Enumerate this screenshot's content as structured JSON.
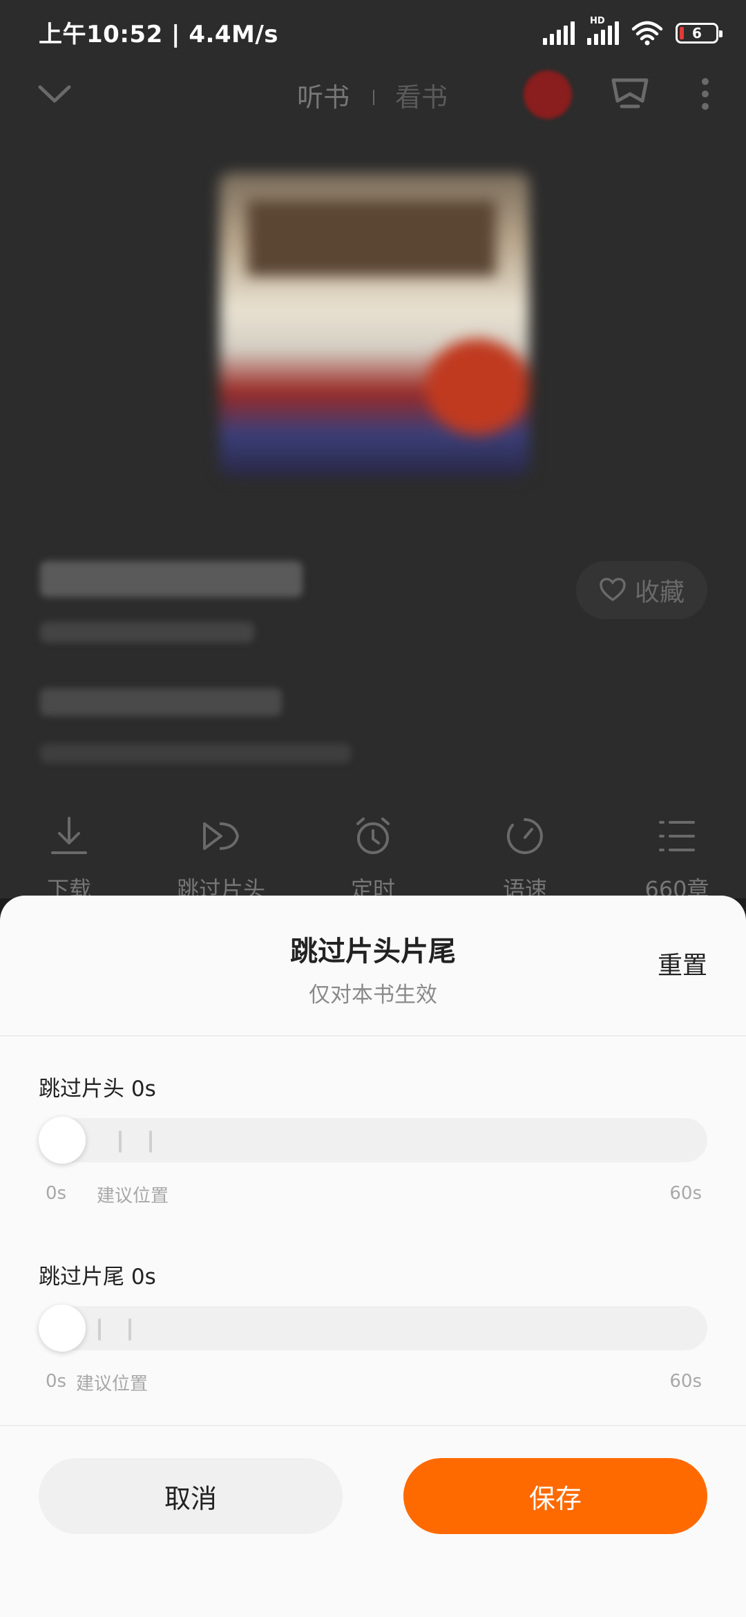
{
  "status_bar": {
    "time_speed": "上午10:52 | 4.4M/s",
    "hd": "HD",
    "battery": "6",
    "battery_color": "#e53935"
  },
  "player": {
    "tabs": [
      "听书",
      "看书"
    ],
    "favorite_label": "收藏",
    "actions": [
      {
        "icon": "download-icon",
        "label": "下载"
      },
      {
        "icon": "skip-intro-icon",
        "label": "跳过片头"
      },
      {
        "icon": "alarm-clock-icon",
        "label": "定时"
      },
      {
        "icon": "speed-dial-icon",
        "label": "语速"
      },
      {
        "icon": "chapter-list-icon",
        "label": "660章"
      }
    ]
  },
  "sheet": {
    "title": "跳过片头片尾",
    "subtitle": "仅对本书生效",
    "reset_label": "重置",
    "intro": {
      "label": "跳过片头 0s",
      "value_seconds": 0,
      "max_seconds": 60,
      "min_label": "0s",
      "max_label": "60s",
      "hint": "建议位置"
    },
    "outro": {
      "label": "跳过片尾 0s",
      "value_seconds": 0,
      "max_seconds": 60,
      "min_label": "0s",
      "max_label": "60s",
      "hint": "建议位置"
    },
    "cancel_label": "取消",
    "save_label": "保存",
    "accent_color": "#ff6a00"
  }
}
